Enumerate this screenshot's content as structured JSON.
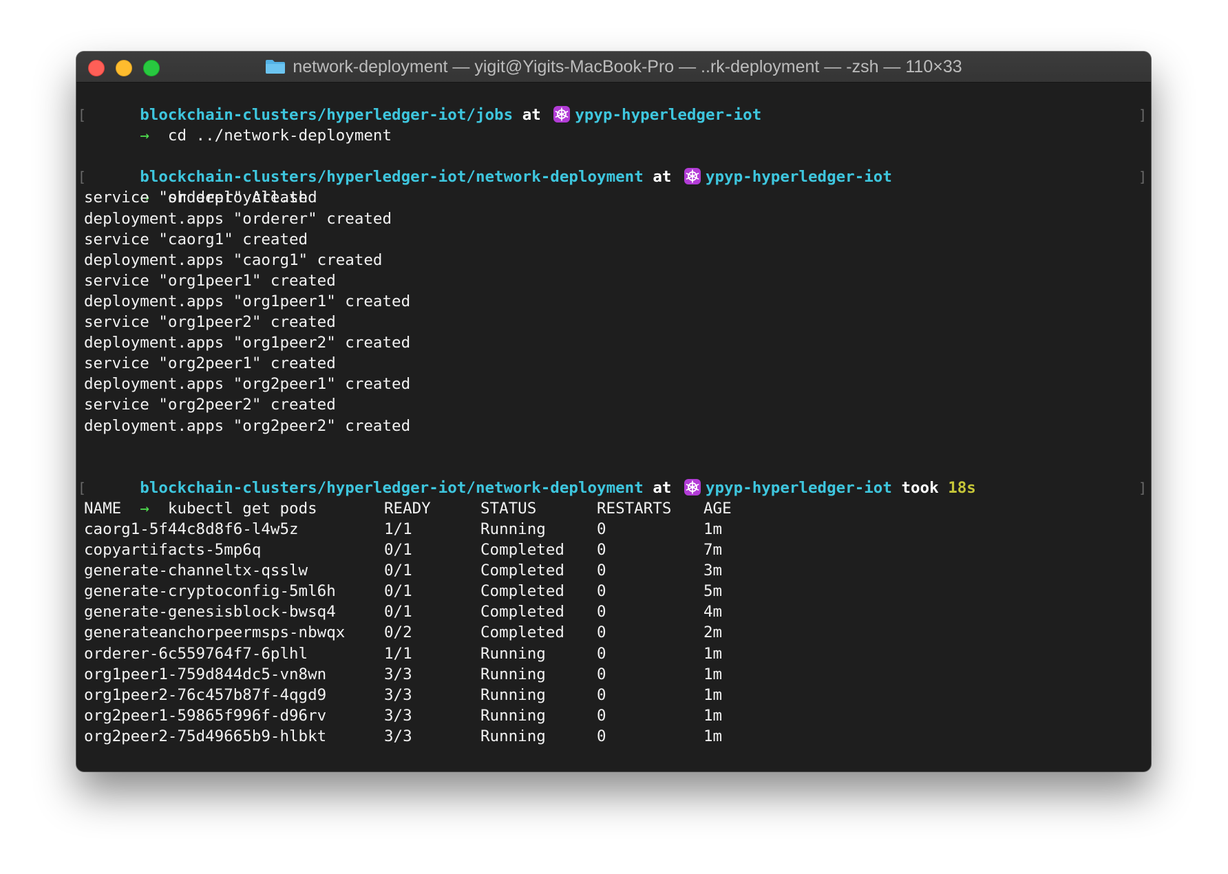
{
  "window": {
    "title": "network-deployment — yigit@Yigits-MacBook-Pro — ..rk-deployment — -zsh — 110×33",
    "icon": "folder-icon"
  },
  "colors": {
    "path": "#3ec6de",
    "arrow": "#4fe04f",
    "duration": "#c6c638",
    "background": "#1e1e1e"
  },
  "prompts": [
    {
      "path": "blockchain-clusters/hyperledger-iot/jobs",
      "at": "at",
      "icon": "kubernetes-icon",
      "context": "ypyp-hyperledger-iot",
      "arrow": "→",
      "command": "cd ../network-deployment"
    },
    {
      "path": "blockchain-clusters/hyperledger-iot/network-deployment",
      "at": "at",
      "icon": "kubernetes-icon",
      "context": "ypyp-hyperledger-iot",
      "arrow": "→",
      "command": "sh deployAll.sh"
    },
    {
      "path": "blockchain-clusters/hyperledger-iot/network-deployment",
      "at": "at",
      "icon": "kubernetes-icon",
      "context": "ypyp-hyperledger-iot",
      "took": "took",
      "duration": "18s",
      "arrow": "→",
      "command": "kubectl get pods"
    }
  ],
  "deploy_output": [
    "service \"orderer\" created",
    "deployment.apps \"orderer\" created",
    "service \"caorg1\" created",
    "deployment.apps \"caorg1\" created",
    "service \"org1peer1\" created",
    "deployment.apps \"org1peer1\" created",
    "service \"org1peer2\" created",
    "deployment.apps \"org1peer2\" created",
    "service \"org2peer1\" created",
    "deployment.apps \"org2peer1\" created",
    "service \"org2peer2\" created",
    "deployment.apps \"org2peer2\" created"
  ],
  "pods_table": {
    "headers": [
      "NAME",
      "READY",
      "STATUS",
      "RESTARTS",
      "AGE"
    ],
    "rows": [
      [
        "caorg1-5f44c8d8f6-l4w5z",
        "1/1",
        "Running",
        "0",
        "1m"
      ],
      [
        "copyartifacts-5mp6q",
        "0/1",
        "Completed",
        "0",
        "7m"
      ],
      [
        "generate-channeltx-qsslw",
        "0/1",
        "Completed",
        "0",
        "3m"
      ],
      [
        "generate-cryptoconfig-5ml6h",
        "0/1",
        "Completed",
        "0",
        "5m"
      ],
      [
        "generate-genesisblock-bwsq4",
        "0/1",
        "Completed",
        "0",
        "4m"
      ],
      [
        "generateanchorpeermsps-nbwqx",
        "0/2",
        "Completed",
        "0",
        "2m"
      ],
      [
        "orderer-6c559764f7-6plhl",
        "1/1",
        "Running",
        "0",
        "1m"
      ],
      [
        "org1peer1-759d844dc5-vn8wn",
        "3/3",
        "Running",
        "0",
        "1m"
      ],
      [
        "org1peer2-76c457b87f-4qgd9",
        "3/3",
        "Running",
        "0",
        "1m"
      ],
      [
        "org2peer1-59865f996f-d96rv",
        "3/3",
        "Running",
        "0",
        "1m"
      ],
      [
        "org2peer2-75d49665b9-hlbkt",
        "3/3",
        "Running",
        "0",
        "1m"
      ]
    ]
  }
}
